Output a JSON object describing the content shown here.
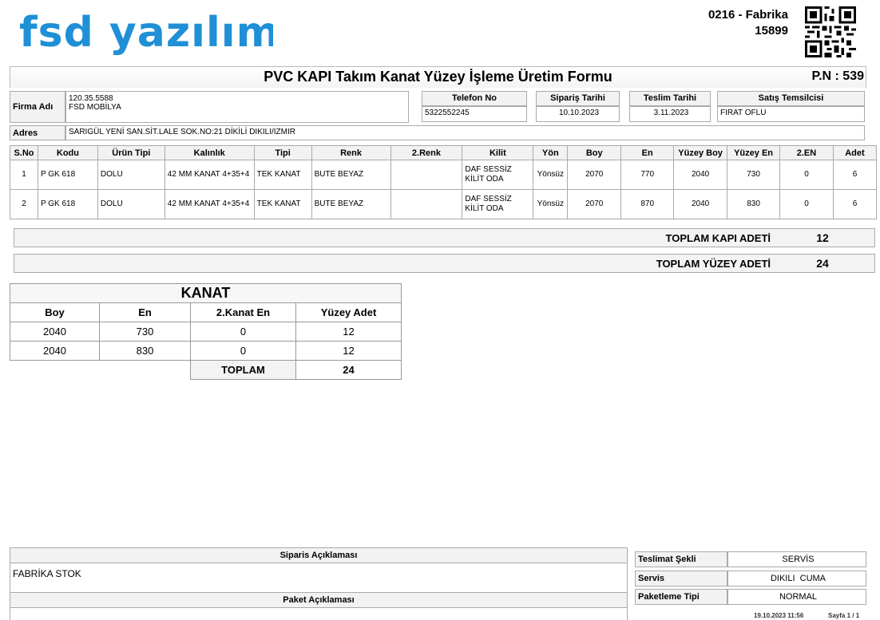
{
  "header": {
    "logo_text": "fsd yazılım",
    "branch": "0216 - Fabrika",
    "number": "15899",
    "title": "PVC KAPI Takım Kanat Yüzey İşleme Üretim Formu",
    "pn": "P.N : 539"
  },
  "info": {
    "firma_label": "Firma Adı",
    "firma_code": "120.35.5588",
    "firma_name": "FSD MOBİLYA",
    "telefon_label": "Telefon No",
    "telefon": "5322552245",
    "siparis_label": "Sipariş Tarihi",
    "siparis": "10.10.2023",
    "teslim_label": "Teslim Tarihi",
    "teslim": "3.11.2023",
    "satis_label": "Satış Temsilcisi",
    "satis": "FIRAT OFLU",
    "adres_label": "Adres",
    "adres": "SARIGÜL YENİ SAN.SİT.LALE SOK.NO:21 DİKİLİ DIKILI/IZMIR"
  },
  "table": {
    "columns": [
      "S.No",
      "Kodu",
      "Ürün Tipi",
      "Kalınlık",
      "Tipi",
      "Renk",
      "2.Renk",
      "Kilit",
      "Yön",
      "Boy",
      "En",
      "Yüzey Boy",
      "Yüzey En",
      "2.EN",
      "Adet"
    ],
    "rows": [
      [
        "1",
        "P GK 618",
        "DOLU",
        "42 MM KANAT 4+35+4",
        "TEK KANAT",
        "BUTE BEYAZ",
        "",
        "DAF SESSİZ KİLİT ODA",
        "Yönsüz",
        "2070",
        "770",
        "2040",
        "730",
        "0",
        "6"
      ],
      [
        "2",
        "P GK 618",
        "DOLU",
        "42 MM KANAT 4+35+4",
        "TEK KANAT",
        "BUTE BEYAZ",
        "",
        "DAF SESSİZ KİLİT ODA",
        "Yönsüz",
        "2070",
        "870",
        "2040",
        "830",
        "0",
        "6"
      ]
    ]
  },
  "totals": {
    "kapi_label": "TOPLAM KAPI ADETİ",
    "kapi_value": "12",
    "yuzey_label": "TOPLAM YÜZEY ADETİ",
    "yuzey_value": "24"
  },
  "kanat": {
    "title": "KANAT",
    "columns": [
      "Boy",
      "En",
      "2.Kanat En",
      "Yüzey Adet"
    ],
    "rows": [
      [
        "2040",
        "730",
        "0",
        "12"
      ],
      [
        "2040",
        "830",
        "0",
        "12"
      ]
    ],
    "total_label": "TOPLAM",
    "total_value": "24"
  },
  "bottom": {
    "siparis_aciklama_label": "Siparis Açıklaması",
    "siparis_aciklama": "FABRİKA STOK",
    "paket_aciklama_label": "Paket Açıklaması",
    "teslimat_label": "Teslimat Şekli",
    "teslimat": "SERVİS",
    "servis_label": "Servis",
    "servis": "DIKILI  CUMA",
    "paket_tipi_label": "Paketleme Tipi",
    "paket_tipi": "NORMAL",
    "timestamp": "19.10.2023 11:56",
    "page": "Sayfa 1 / 1"
  },
  "colors": {
    "logo": "#1f8fd6"
  }
}
